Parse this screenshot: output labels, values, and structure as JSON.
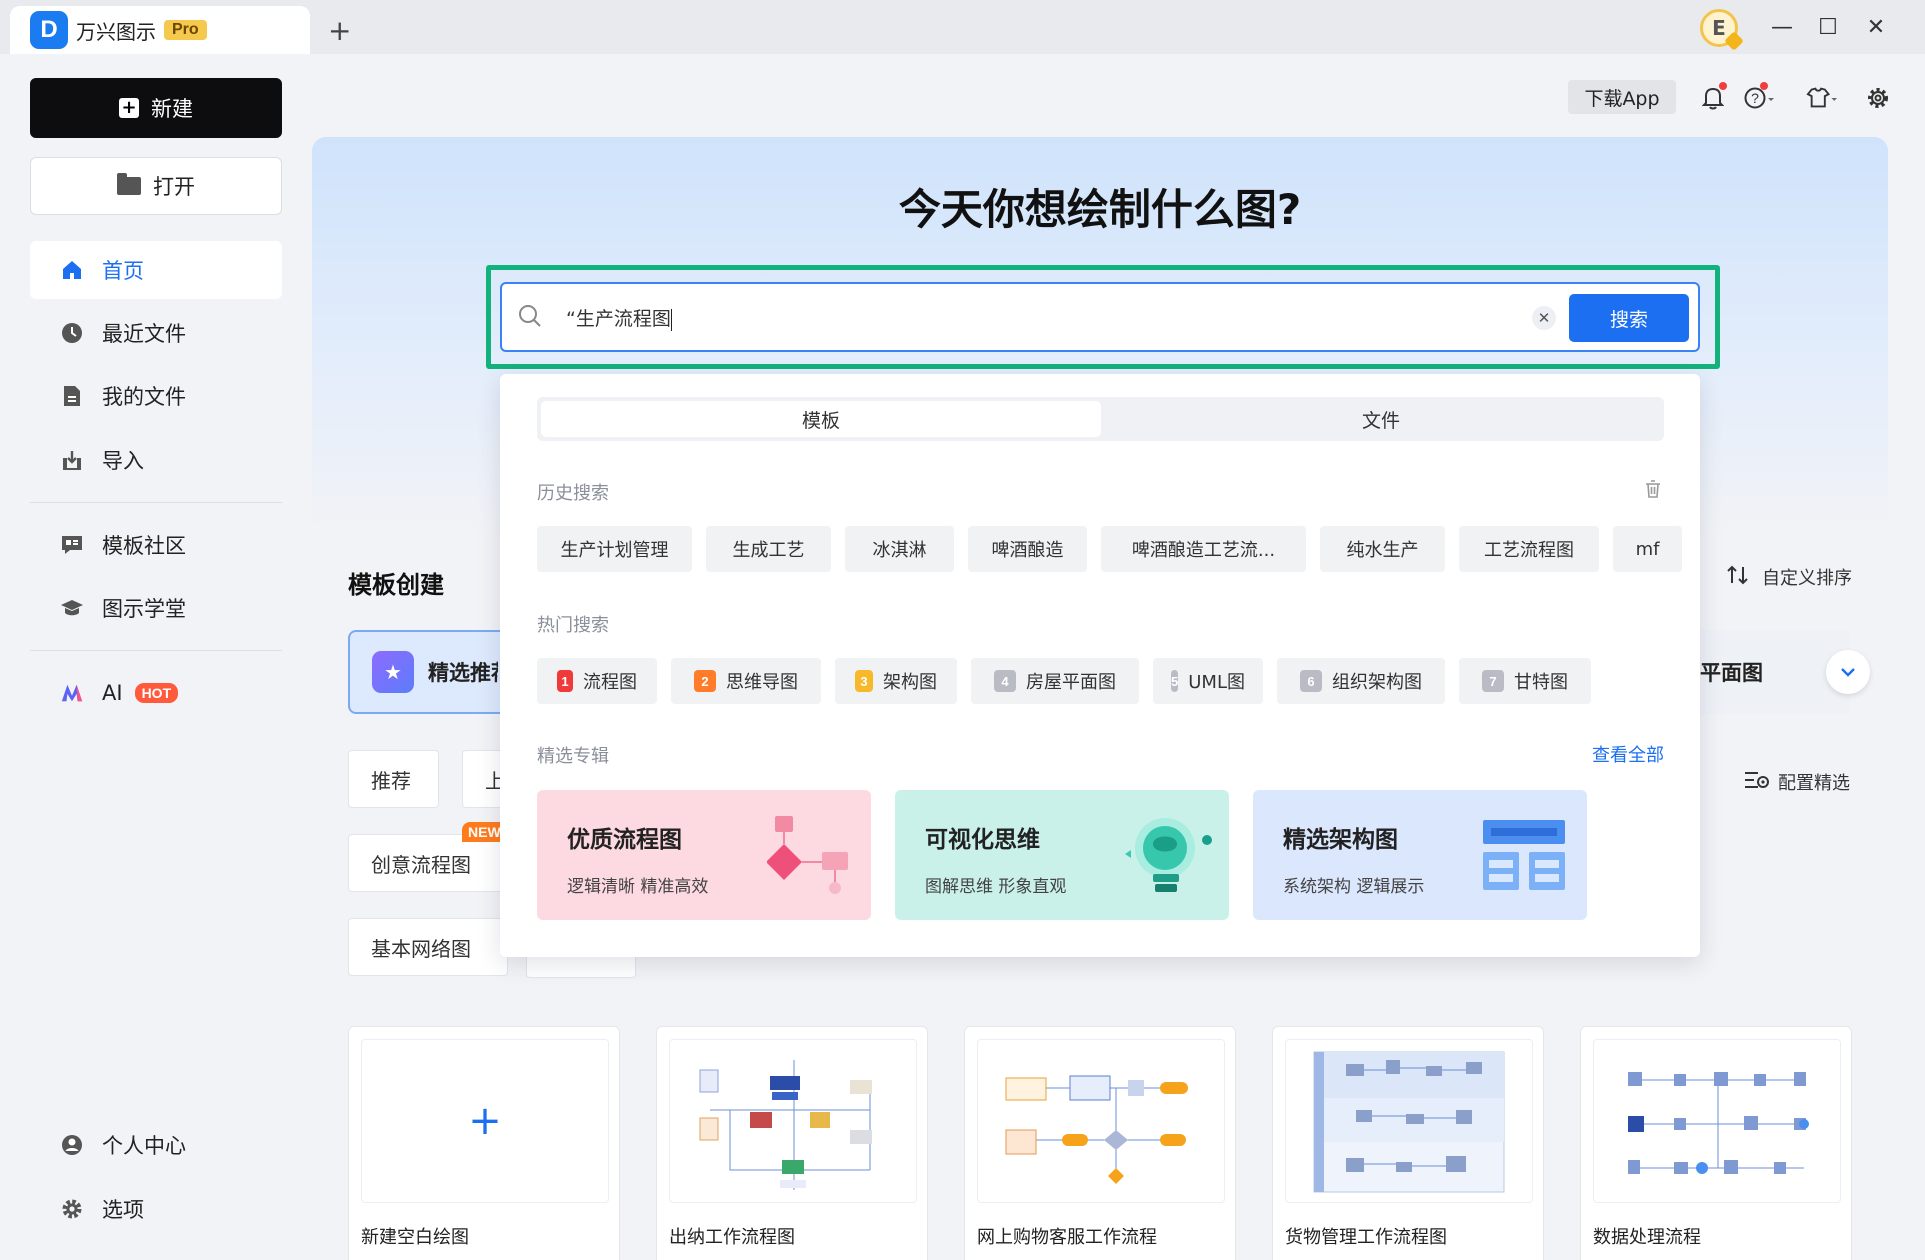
{
  "app": {
    "name": "万兴图示",
    "badge": "Pro",
    "new_tab": "+",
    "avatar": "E"
  },
  "window": {
    "minimize": "—",
    "maximize": "☐",
    "close": "✕"
  },
  "sidebar": {
    "new_label": "新建",
    "open_label": "打开",
    "items": [
      {
        "label": "首页",
        "icon": "home-icon",
        "active": true
      },
      {
        "label": "最近文件",
        "icon": "clock-icon"
      },
      {
        "label": "我的文件",
        "icon": "file-icon"
      },
      {
        "label": "导入",
        "icon": "import-icon"
      },
      {
        "label": "模板社区",
        "icon": "community-icon"
      },
      {
        "label": "图示学堂",
        "icon": "graduation-cap-icon"
      },
      {
        "label": "AI",
        "icon": "ai-icon",
        "badge": "HOT"
      }
    ],
    "bottom": [
      {
        "label": "个人中心",
        "icon": "user-icon"
      },
      {
        "label": "选项",
        "icon": "gear-icon"
      }
    ]
  },
  "toolbar": {
    "download_app": "下载App"
  },
  "banner": {
    "title": "今天你想绘制什么图?"
  },
  "search": {
    "value": "“生产流程图",
    "button": "搜索",
    "clear": "✕"
  },
  "dropdown": {
    "tabs": [
      {
        "label": "模板",
        "active": true
      },
      {
        "label": "文件"
      }
    ],
    "history_label": "历史搜索",
    "history": [
      "生产计划管理",
      "生成工艺",
      "冰淇淋",
      "啤酒酿造",
      "啤酒酿造工艺流...",
      "纯水生产",
      "工艺流程图",
      "mf"
    ],
    "hot_label": "热门搜索",
    "hot": [
      {
        "rank": "1",
        "label": "流程图",
        "color": "#f03a3a"
      },
      {
        "rank": "2",
        "label": "思维导图",
        "color": "#ff7d2a"
      },
      {
        "rank": "3",
        "label": "架构图",
        "color": "#f7b82a"
      },
      {
        "rank": "4",
        "label": "房屋平面图",
        "color": "#b9bcc4"
      },
      {
        "rank": "5",
        "label": "UML图",
        "color": "#b9bcc4"
      },
      {
        "rank": "6",
        "label": "组织架构图",
        "color": "#b9bcc4"
      },
      {
        "rank": "7",
        "label": "甘特图",
        "color": "#b9bcc4"
      }
    ],
    "topics_label": "精选专辑",
    "view_all": "查看全部",
    "topics": [
      {
        "title": "优质流程图",
        "subtitle": "逻辑清晰 精准高效",
        "bg": "#fdd9e1"
      },
      {
        "title": "可视化思维",
        "subtitle": "图解思维 形象直观",
        "bg": "#c9f1ea"
      },
      {
        "title": "精选架构图",
        "subtitle": "系统架构 逻辑展示",
        "bg": "#dae7fd"
      }
    ]
  },
  "templates": {
    "section_title": "模板创建",
    "sort_label": "自定义排序",
    "category_partial": "精选推荐",
    "category_tail": "平面图",
    "pills": [
      "推荐",
      "上",
      "创意流程图",
      "基本网络图"
    ],
    "new_badge": "NEW",
    "config_label": "配置精选",
    "cards": [
      {
        "label": "新建空白绘图",
        "blank_plus": "+"
      },
      {
        "label": "出纳工作流程图"
      },
      {
        "label": "网上购物客服工作流程"
      },
      {
        "label": "货物管理工作流程图"
      },
      {
        "label": "数据处理流程"
      }
    ]
  }
}
